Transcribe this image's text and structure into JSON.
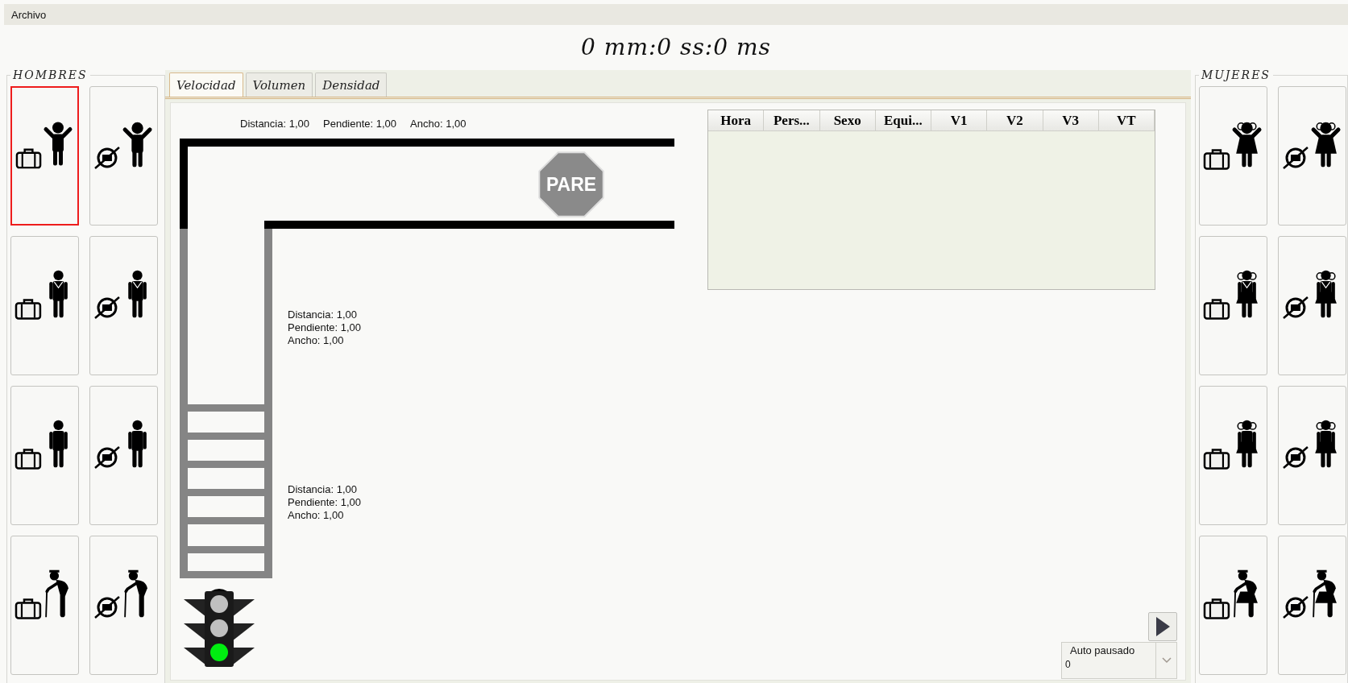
{
  "menu": [
    "Archivo"
  ],
  "timer": "0 mm:0 ss:0 ms",
  "panels": [
    {
      "title": "HOMBRES",
      "kind": "male",
      "buttons": [
        {
          "kind": "child",
          "luggage": true,
          "selected": true
        },
        {
          "kind": "child",
          "luggage": false,
          "selected": false
        },
        {
          "kind": "suit",
          "luggage": true,
          "selected": false
        },
        {
          "kind": "suit",
          "luggage": false,
          "selected": false
        },
        {
          "kind": "adult",
          "luggage": true,
          "selected": false
        },
        {
          "kind": "adult",
          "luggage": false,
          "selected": false
        },
        {
          "kind": "elder",
          "luggage": true,
          "selected": false
        },
        {
          "kind": "elder",
          "luggage": false,
          "selected": false
        }
      ]
    },
    {
      "title": "MUJERES",
      "kind": "female",
      "buttons": [
        {
          "kind": "child",
          "luggage": true,
          "selected": false
        },
        {
          "kind": "child",
          "luggage": false,
          "selected": false
        },
        {
          "kind": "suit",
          "luggage": true,
          "selected": false
        },
        {
          "kind": "suit",
          "luggage": false,
          "selected": false
        },
        {
          "kind": "adult",
          "luggage": true,
          "selected": false
        },
        {
          "kind": "adult",
          "luggage": false,
          "selected": false
        },
        {
          "kind": "elder",
          "luggage": true,
          "selected": false
        },
        {
          "kind": "elder",
          "luggage": false,
          "selected": false
        }
      ]
    }
  ],
  "tabs": [
    {
      "label": "Velocidad",
      "selected": true
    },
    {
      "label": "Volumen",
      "selected": false
    },
    {
      "label": "Densidad",
      "selected": false
    }
  ],
  "canvas": {
    "segments": [
      {
        "kind": "horizontal",
        "labels": [
          "Distancia: 1,00",
          "Pendiente: 1,00",
          "Ancho: 1,00"
        ]
      },
      {
        "kind": "vertical",
        "labels": [
          "Distancia: 1,00",
          "Pendiente: 1,00",
          "Ancho: 1,00"
        ]
      },
      {
        "kind": "vertical",
        "labels": [
          "Distancia: 1,00",
          "Pendiente: 1,00",
          "Ancho: 1,00"
        ]
      }
    ],
    "stop_sign": "PARE",
    "traffic_light": {
      "lights": [
        {
          "on": false
        },
        {
          "on": false
        },
        {
          "on": true
        }
      ]
    }
  },
  "table": {
    "columns": [
      "Hora",
      "Pers...",
      "Sexo",
      "Equi...",
      "V1",
      "V2",
      "V3",
      "VT"
    ]
  },
  "auto_pause": {
    "label": "Auto pausado",
    "value": "0"
  }
}
